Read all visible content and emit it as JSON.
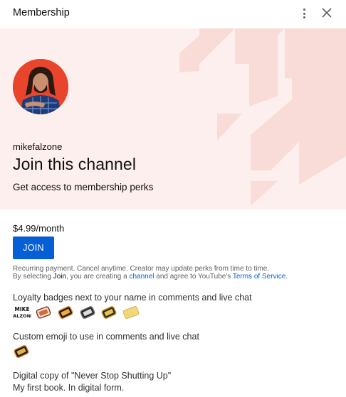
{
  "header": {
    "title": "Membership"
  },
  "banner": {
    "channel_name": "mikefalzone",
    "heading": "Join this channel",
    "subheading": "Get access to membership perks"
  },
  "offer": {
    "price": "$4.99/month",
    "join_label": "JOIN",
    "fine_line1": "Recurring payment. Cancel anytime. Creator may update perks from time to time.",
    "fine_prefix": "By selecting ",
    "fine_join_word": "Join",
    "fine_mid": ", you are creating a ",
    "fine_channel_link": "channel",
    "fine_and": " and agree to YouTube's ",
    "fine_tos_link": "Terms of Service",
    "fine_end": "."
  },
  "perks": [
    {
      "title": "Loyalty badges next to your name in comments and live chat",
      "badges": [
        {
          "name": "mike-falzone-logo-badge",
          "text": "MIKE FALZONE"
        },
        {
          "name": "tag-badge-1"
        },
        {
          "name": "tag-badge-2"
        },
        {
          "name": "tag-badge-3"
        },
        {
          "name": "tag-badge-4"
        },
        {
          "name": "gold-ticket-badge"
        }
      ]
    },
    {
      "title": "Custom emoji to use in comments and live chat"
    },
    {
      "title": "Digital copy of \"Never Stop Shutting Up\"",
      "subtitle": "My first book. In digital form."
    }
  ],
  "colors": {
    "banner_bg": "#fdefed",
    "accent": "#065fd4",
    "avatar_bg": "#e8452c"
  }
}
